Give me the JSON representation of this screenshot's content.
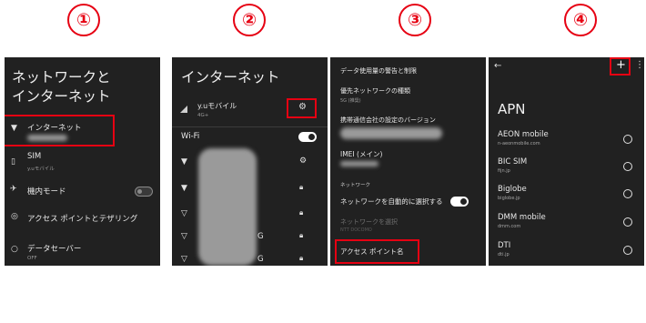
{
  "steps": [
    "①",
    "②",
    "③",
    "④"
  ],
  "screen1": {
    "title": "ネットワークと\nインターネット",
    "items": [
      {
        "label": "インターネット",
        "sub": ""
      },
      {
        "label": "SIM",
        "sub": "y.uモバイル"
      },
      {
        "label": "機内モード",
        "sub": ""
      },
      {
        "label": "アクセス ポイントとテザリング",
        "sub": ""
      },
      {
        "label": "データセーバー",
        "sub": "OFF"
      }
    ]
  },
  "screen2": {
    "title": "インターネット",
    "carrier": "y.uモバイル",
    "carrier_sub": "4G+",
    "wifi_label": "Wi-Fi",
    "network_suffix": "G"
  },
  "screen3": {
    "rows": [
      {
        "label": "データ使用量の警告と制限",
        "sub": ""
      },
      {
        "label": "優先ネットワークの種類",
        "sub": "5G (推奨)"
      },
      {
        "label": "携帯通信会社の設定のバージョン",
        "sub": ""
      },
      {
        "label": "IMEI (メイン)",
        "sub": ""
      }
    ],
    "section": "ネットワーク",
    "auto_select": "ネットワークを自動的に選択する",
    "choose_network": "ネットワークを選択",
    "choose_network_sub": "NTT DOCOMO",
    "apn": "アクセス ポイント名"
  },
  "screen4": {
    "title": "APN",
    "back_icon": "←",
    "add_icon": "+",
    "more_icon": "⋮",
    "apns": [
      {
        "name": "AEON mobile",
        "url": "n-aeonmobile.com"
      },
      {
        "name": "BIC SIM",
        "url": "fijn.jp"
      },
      {
        "name": "Biglobe",
        "url": "biglobe.jp"
      },
      {
        "name": "DMM mobile",
        "url": "dmm.com"
      },
      {
        "name": "DTI",
        "url": "dti.jp"
      }
    ]
  }
}
